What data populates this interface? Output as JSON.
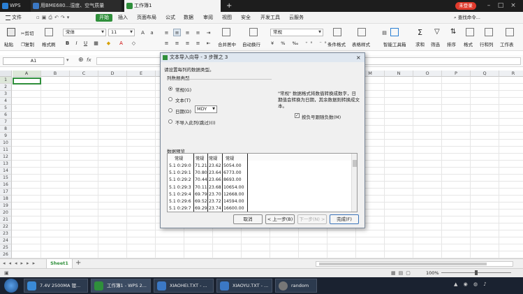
{
  "titlebar": {
    "app_label": "WPS",
    "tab1_title": "用BME680...湿度、空气质量",
    "tab2_title": "工作簿1",
    "new_tab": "+",
    "login": "未登录",
    "win_min": "–",
    "win_max": "□",
    "win_close": "×"
  },
  "menubar": {
    "file": "文件",
    "items": [
      "开始",
      "插入",
      "页面布局",
      "公式",
      "数据",
      "审阅",
      "视图",
      "安全",
      "开发工具",
      "云服务"
    ],
    "search_command": "查找命令..."
  },
  "ribbon": {
    "paste": "粘贴",
    "cut": "剪切",
    "copy": "复制",
    "format_painter": "格式刷",
    "font_name": "宋体",
    "font_size": "11",
    "format_general": "常规",
    "merge_center": "合并居中",
    "auto_wrap": "自动换行",
    "cond_format": "条件格式",
    "table_style": "表格样式",
    "smart_toolbox": "智能工具箱",
    "sum": "求和",
    "filter": "筛选",
    "sort": "排序",
    "format": "格式",
    "row_col": "行和列",
    "worksheet": "工作表"
  },
  "formula": {
    "name_box": "A1",
    "fx": "fx"
  },
  "grid": {
    "columns": [
      "A",
      "B",
      "C",
      "D",
      "E",
      "F",
      "G",
      "H",
      "I",
      "J",
      "K",
      "L",
      "M",
      "N",
      "O",
      "P",
      "Q",
      "R"
    ],
    "rows": [
      "1",
      "2",
      "3",
      "4",
      "5",
      "6",
      "7",
      "8",
      "9",
      "10",
      "11",
      "12",
      "13",
      "14",
      "15",
      "16",
      "17",
      "18",
      "19",
      "20",
      "21",
      "22",
      "23",
      "24",
      "25",
      "26"
    ]
  },
  "sheetbar": {
    "sheet1": "Sheet1",
    "add": "+"
  },
  "statusbar": {
    "zoom": "100%"
  },
  "taskbar": {
    "tasks": [
      "7.4V 2500MA 锂...",
      "工作簿1 - WPS 2...",
      "XIAOHEI.TXT - ...",
      "XIAOYU.TXT - ...",
      "random"
    ]
  },
  "dialog": {
    "title": "文本导入向导 - 3 步骤之 3",
    "prompt": "请设置每列的数据类型。",
    "group_label": "列数据类型",
    "opt_general": "常规(G)",
    "opt_text": "文本(T)",
    "opt_date": "日期(D)",
    "date_format": "MDY",
    "opt_skip": "不导入此列(跳过)(I)",
    "description": "\"常规\" 数据格式将数值转换成数字，日期值会转换为日期，其余数据则转换成文本。",
    "negative_label": "按负号跟随负数(M)",
    "preview_label": "数据预览",
    "preview": {
      "headers": [
        "常规",
        "常规",
        "常规",
        "常规"
      ],
      "rows": [
        [
          "5.1 0:29:0",
          "71.21",
          "23.62",
          "5054.00"
        ],
        [
          "5.1 0:29:1",
          "70.80",
          "23.64",
          "6773.00"
        ],
        [
          "5.1 0:29:2",
          "70.44",
          "23.66",
          "8693.00"
        ],
        [
          "5.1 0:29:3",
          "70.11",
          "23.68",
          "10654.00"
        ],
        [
          "5.1 0:29:4",
          "69.79",
          "23.70",
          "12668.00"
        ],
        [
          "5.1 0:29:6",
          "69.52",
          "23.72",
          "14594.00"
        ],
        [
          "5.1 0:29:7",
          "69.29",
          "23.74",
          "16600.00"
        ]
      ]
    },
    "btn_cancel": "取消",
    "btn_back": "< 上一步(B)",
    "btn_next": "下一步(N) >",
    "btn_finish": "完成(F)"
  }
}
